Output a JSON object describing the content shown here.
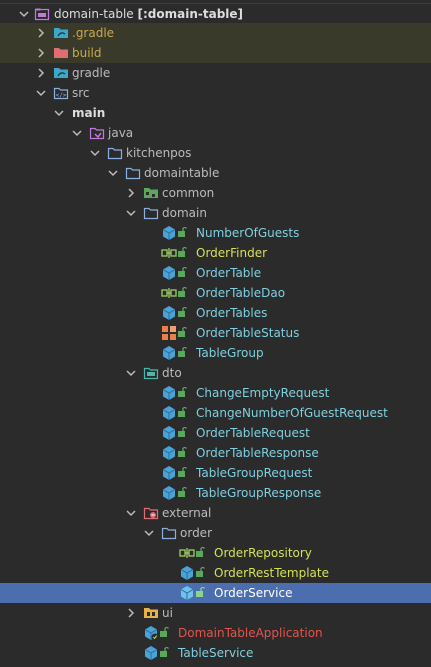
{
  "colors": {
    "background": "#2b2b2b",
    "selection": "#4b6eaf",
    "excluded_row": "#3a3a2a",
    "folder_blue": "#88b0e0",
    "label_default": "#bbbbbb",
    "label_cyan": "#7ed0e0",
    "label_yellow_green": "#d4e157",
    "label_excluded": "#c9a84c",
    "label_red": "#e5534b",
    "label_white": "#ffffff"
  },
  "tree": {
    "root": {
      "name": "domain-table",
      "module": "[:domain-table]"
    },
    "nodes": {
      "gradle_hidden": ".gradle",
      "build": "build",
      "gradle": "gradle",
      "src": "src",
      "main": "main",
      "java": "java",
      "kitchenpos": "kitchenpos",
      "domaintable": "domaintable",
      "common": "common",
      "domain": "domain",
      "number_of_guests": "NumberOfGuests",
      "order_finder": "OrderFinder",
      "order_table": "OrderTable",
      "order_table_dao": "OrderTableDao",
      "order_tables": "OrderTables",
      "order_table_status": "OrderTableStatus",
      "table_group": "TableGroup",
      "dto": "dto",
      "change_empty_request": "ChangeEmptyRequest",
      "change_number_of_guest_request": "ChangeNumberOfGuestRequest",
      "order_table_request": "OrderTableRequest",
      "order_table_response": "OrderTableResponse",
      "table_group_request": "TableGroupRequest",
      "table_group_response": "TableGroupResponse",
      "external": "external",
      "order": "order",
      "order_repository": "OrderRepository",
      "order_rest_template": "OrderRestTemplate",
      "order_service": "OrderService",
      "ui": "ui",
      "domain_table_application": "DomainTableApplication",
      "table_service": "TableService"
    }
  }
}
